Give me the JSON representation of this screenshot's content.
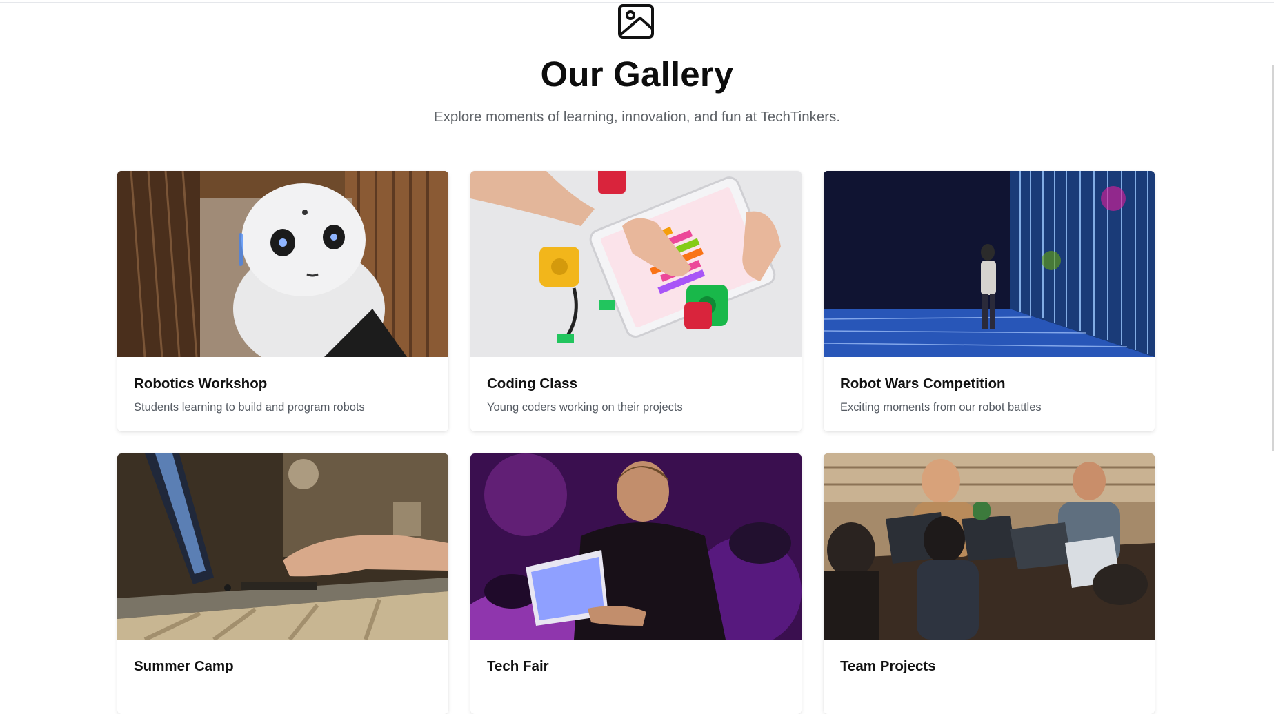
{
  "header": {
    "icon": "image-icon",
    "title": "Our Gallery",
    "subtitle": "Explore moments of learning, innovation, and fun at TechTinkers."
  },
  "gallery": [
    {
      "title": "Robotics Workshop",
      "description": "Students learning to build and program robots",
      "image": "robot-photo"
    },
    {
      "title": "Coding Class",
      "description": "Young coders working on their projects",
      "image": "tablet-coding-photo"
    },
    {
      "title": "Robot Wars Competition",
      "description": "Exciting moments from our robot battles",
      "image": "light-installation-photo"
    },
    {
      "title": "Summer Camp",
      "description": "",
      "image": "laptop-typing-photo"
    },
    {
      "title": "Tech Fair",
      "description": "",
      "image": "hackathon-photo"
    },
    {
      "title": "Team Projects",
      "description": "",
      "image": "team-laptops-photo"
    }
  ]
}
